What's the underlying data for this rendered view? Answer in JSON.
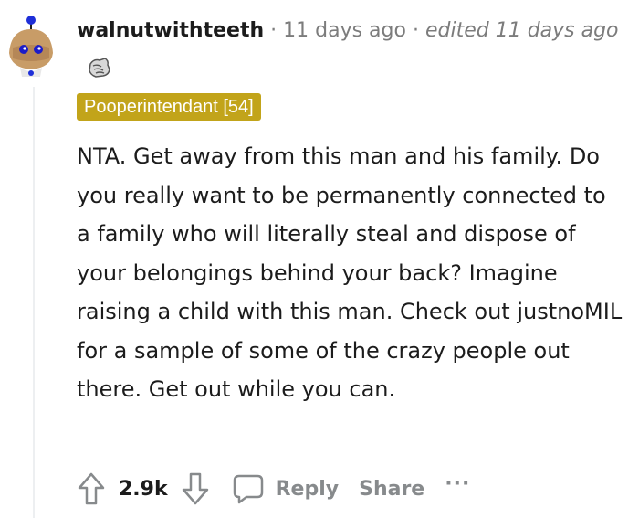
{
  "comment": {
    "username": "walnutwithteeth",
    "separator": "·",
    "time": "11 days ago",
    "edited": "edited 11 days ago",
    "flair": "Pooperintendant [54]",
    "body": "NTA. Get away from this man and his family. Do you really want to be permanently connected to a family who will literally steal and dispose of your belongings behind your back? Imagine raising a child with this man. Check out justnoMIL for a sample of some of the crazy people out there. Get out while you can."
  },
  "actions": {
    "score": "2.9k",
    "reply_label": "Reply",
    "share_label": "Share",
    "more_label": "···"
  },
  "icons": {
    "avatar": "snoo-avatar",
    "award": "award-icon",
    "upvote": "upvote-icon",
    "downvote": "downvote-icon",
    "reply": "comment-bubble-icon"
  },
  "colors": {
    "flair_background": "#c2a41a",
    "meta_gray": "#7c7c7c",
    "action_gray": "#878a8c",
    "thread_line": "#edeff1"
  }
}
